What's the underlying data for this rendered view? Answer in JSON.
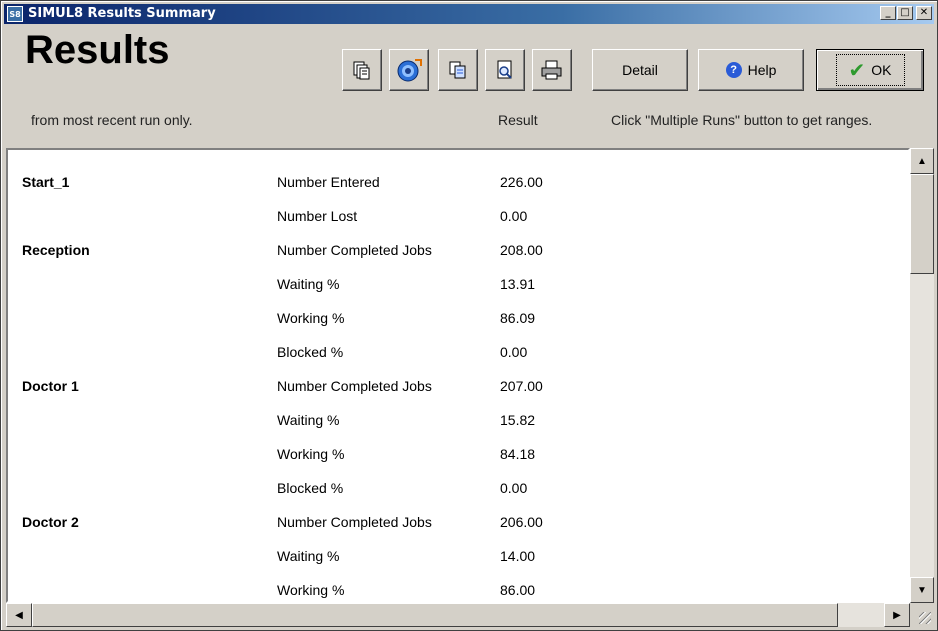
{
  "window": {
    "app_icon_text": "S8",
    "title": "SIMUL8 Results Summary",
    "minimize_label": "_",
    "maximize_label": "□",
    "close_label": "✕"
  },
  "header": {
    "title": "Results",
    "subtitle": "from most recent run only.",
    "result_column": "Result",
    "ranges_note": "Click \"Multiple Runs\" button to get ranges."
  },
  "toolbar": {
    "icons": [
      "clipboard-stack-icon",
      "globe-refresh-icon",
      "copy-icon",
      "preview-icon",
      "printer-icon"
    ],
    "detail_label": "Detail",
    "help_label": "Help",
    "ok_label": "OK",
    "help_icon_glyph": "?",
    "ok_icon_glyph": "✔"
  },
  "rows": [
    {
      "object": "Start_1",
      "stat": "Number Entered",
      "value": "226.00"
    },
    {
      "object": "",
      "stat": "Number Lost",
      "value": "0.00"
    },
    {
      "object": "Reception",
      "stat": "Number Completed Jobs",
      "value": "208.00"
    },
    {
      "object": "",
      "stat": "Waiting %",
      "value": "13.91"
    },
    {
      "object": "",
      "stat": "Working %",
      "value": "86.09"
    },
    {
      "object": "",
      "stat": "Blocked %",
      "value": "0.00"
    },
    {
      "object": "Doctor 1",
      "stat": "Number Completed Jobs",
      "value": "207.00"
    },
    {
      "object": "",
      "stat": "Waiting %",
      "value": "15.82"
    },
    {
      "object": "",
      "stat": "Working %",
      "value": "84.18"
    },
    {
      "object": "",
      "stat": "Blocked %",
      "value": "0.00"
    },
    {
      "object": "Doctor 2",
      "stat": "Number Completed Jobs",
      "value": "206.00"
    },
    {
      "object": "",
      "stat": "Waiting %",
      "value": "14.00"
    },
    {
      "object": "",
      "stat": "Working %",
      "value": "86.00"
    }
  ],
  "colors": {
    "titlebar_start": "#0a246a",
    "titlebar_end": "#a6caf0",
    "face": "#d4d0c8",
    "ok_check": "#2e9a2e",
    "help_icon": "#2a5bd7"
  }
}
